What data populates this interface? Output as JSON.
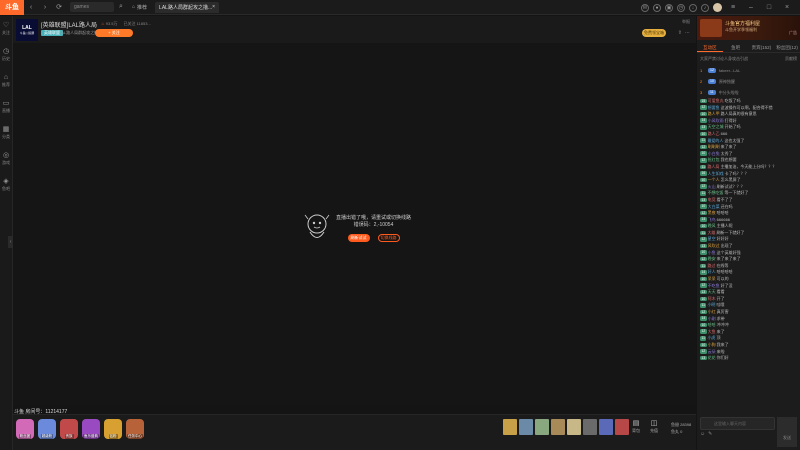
{
  "topbar": {
    "logo": "斗鱼",
    "search_placeholder": "games",
    "tab1": "推荐",
    "tab_active": "LAL路人局群起攻之撸...",
    "tab_close": "×"
  },
  "sidebar": {
    "items": [
      {
        "label": "关注",
        "icon": "heart-icon"
      },
      {
        "label": "历史",
        "icon": "clock-icon"
      },
      {
        "label": "推荐",
        "icon": "home-icon"
      },
      {
        "label": "直播",
        "icon": "tv-icon"
      },
      {
        "label": "分类",
        "icon": "grid-icon"
      },
      {
        "label": "游戏",
        "icon": "gamepad-icon"
      },
      {
        "label": "鱼吧",
        "icon": "fish-icon"
      }
    ]
  },
  "room": {
    "logo_top": "LAL",
    "logo_bottom": "斗鱼 | 投屏",
    "title": "[英雄联盟]LAL路人局",
    "hot": "93.5万",
    "follows": "已关注 11853...",
    "category": "英雄联盟",
    "sub": "LAL路人局群起攻之撸",
    "follow_btn": "+ 关注",
    "right_info": "举报",
    "gold_badge": "免费领宝箱"
  },
  "video": {
    "err_line1": "直播出错了哦，请重试或切换线路",
    "err_line2": "错误码：2,-10054",
    "refresh_btn": "刷新试试",
    "switch_btn": "切换线路",
    "room_number": "斗鱼 房间号：11214177"
  },
  "bottom": {
    "gifts_left": [
      {
        "label": "粉丝团",
        "color": "#d36ab8"
      },
      {
        "label": "超级粉",
        "color": "#6b8adc"
      },
      {
        "label": "贵族",
        "color": "#c04a4a"
      },
      {
        "label": "鱼乐盛典",
        "color": "#9a4ac0"
      },
      {
        "label": "钻粉",
        "color": "#d8a030"
      },
      {
        "label": "任务中心",
        "color": "#b8623a"
      }
    ],
    "ic1": "背包",
    "ic2": "充值",
    "balance1": "鱼翅 28398",
    "balance2": "鱼丸 0"
  },
  "right": {
    "ad_title": "斗鱼官方福利屋",
    "ad_sub": "斗鱼开学季领福利",
    "ad_tag": "广告",
    "tabs": [
      "互动区",
      "鱼吧",
      "贵宾(152)",
      "粉丝团(12)"
    ],
    "hint_left": "大家严禁讨论人身攻击引战",
    "hint_right": "贡献榜",
    "rank": [
      {
        "num": "1",
        "tag": "12",
        "name": "fakeer...LAL"
      },
      {
        "num": "2",
        "tag": "10",
        "name": "原神独醒"
      },
      {
        "num": "3",
        "tag": "11",
        "name": "中分头啦啦"
      }
    ],
    "messages": [
      {
        "lv": "15",
        "name": "可爱鱼丸",
        "text": "吃饭了吗"
      },
      {
        "lv": "12",
        "name": "想要鱼",
        "text": "这波操作可以啊，配合得不错"
      },
      {
        "lv": "10",
        "name": "路人甲",
        "text": "路人局真的很有意思"
      },
      {
        "lv": "14",
        "name": "小风吹雨",
        "text": "打得好"
      },
      {
        "lv": "13",
        "name": "天空之城",
        "text": "开始了吗"
      },
      {
        "lv": "10",
        "name": "路人乙",
        "text": "666"
      },
      {
        "lv": "11",
        "name": "最爱的人",
        "text": "这也太强了"
      },
      {
        "lv": "12",
        "name": "刷刷刷",
        "text": "来了来了"
      },
      {
        "lv": "10",
        "name": "小白兔",
        "text": "太秀了"
      },
      {
        "lv": "12",
        "name": "抢红包",
        "text": "我也想要"
      },
      {
        "lv": "11",
        "name": "路人局",
        "text": "主播加油，今天能上分吗？？？"
      },
      {
        "lv": "16",
        "name": "人生如戏",
        "text": "卡了吗？？？"
      },
      {
        "lv": "10",
        "name": "一个人",
        "text": "怎么黑屏了"
      },
      {
        "lv": "12",
        "name": "火山",
        "text": "刷新试试？？？"
      },
      {
        "lv": "11",
        "name": "不想吃饭",
        "text": "等一下就好了"
      },
      {
        "lv": "13",
        "name": "电竞",
        "text": "看不了了"
      },
      {
        "lv": "10",
        "name": "大白菜",
        "text": "还在吗"
      },
      {
        "lv": "12",
        "name": "黑夜",
        "text": "哈哈哈"
      },
      {
        "lv": "14",
        "name": "飞鸟",
        "text": "666666"
      },
      {
        "lv": "10",
        "name": "晚风",
        "text": "主播人呢"
      },
      {
        "lv": "11",
        "name": "大雄",
        "text": "刷新一下就好了"
      },
      {
        "lv": "12",
        "name": "星空",
        "text": "好好好"
      },
      {
        "lv": "13",
        "name": "风吹过",
        "text": "出现了"
      },
      {
        "lv": "10",
        "name": "小鱼",
        "text": "这个英雄好强"
      },
      {
        "lv": "12",
        "name": "晚安",
        "text": "来了来了来了"
      },
      {
        "lv": "11",
        "name": "路过",
        "text": "在线等"
      },
      {
        "lv": "14",
        "name": "好人",
        "text": "哈哈哈哈"
      },
      {
        "lv": "10",
        "name": "呆呆",
        "text": "可以的"
      },
      {
        "lv": "12",
        "name": "不吃鱼",
        "text": "好了没"
      },
      {
        "lv": "13",
        "name": "天天",
        "text": "看看"
      },
      {
        "lv": "10",
        "name": "阿木",
        "text": "开了"
      },
      {
        "lv": "11",
        "name": "小明",
        "text": "哇哦"
      },
      {
        "lv": "12",
        "name": "小红",
        "text": "真厉害"
      },
      {
        "lv": "14",
        "name": "小刚",
        "text": "求带"
      },
      {
        "lv": "10",
        "name": "哈哈",
        "text": "冲冲冲"
      },
      {
        "lv": "12",
        "name": "大鱼",
        "text": "来了"
      },
      {
        "lv": "11",
        "name": "小虎",
        "text": "顶"
      },
      {
        "lv": "10",
        "name": "小狗",
        "text": "我来了"
      },
      {
        "lv": "12",
        "name": "云朵",
        "text": "来啦"
      },
      {
        "lv": "13",
        "name": "花花",
        "text": "你们好"
      }
    ],
    "input_placeholder": "这里输入聊天内容",
    "send_btn": "发送"
  }
}
